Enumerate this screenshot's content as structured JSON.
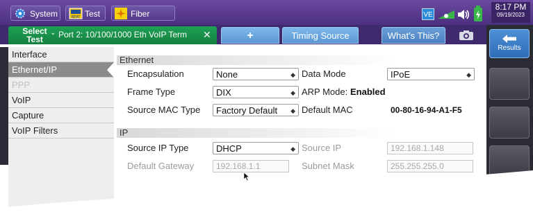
{
  "topbar": {
    "system_label": "System",
    "test_label": "Test",
    "bert_badge": "BERT",
    "fiber_label": "Fiber Optics",
    "ve_badge": "VE",
    "clock_time": "8:17 PM",
    "clock_date": "09/19/2023"
  },
  "tabs": {
    "select_test_line1": "Select",
    "select_test_line2": "Test",
    "port_label": "Port 2: 10/100/1000 Eth VoIP Term",
    "close_symbol": "✕",
    "add_label": "+",
    "timing_source": "Timing Source",
    "whats_this": "What's This?"
  },
  "sidebar": {
    "items": [
      {
        "label": "Interface",
        "state": "normal"
      },
      {
        "label": "Ethernet/IP",
        "state": "active"
      },
      {
        "label": "PPP",
        "state": "disabled"
      },
      {
        "label": "VoIP",
        "state": "normal"
      },
      {
        "label": "Capture",
        "state": "normal"
      },
      {
        "label": "VoIP Filters",
        "state": "normal"
      }
    ]
  },
  "ethernet": {
    "section_title": "Ethernet",
    "encapsulation_label": "Encapsulation",
    "encapsulation_value": "None",
    "data_mode_label": "Data Mode",
    "data_mode_value": "IPoE",
    "frame_type_label": "Frame Type",
    "frame_type_value": "DIX",
    "arp_mode_label": "ARP Mode:",
    "arp_mode_value": "Enabled",
    "source_mac_type_label": "Source MAC Type",
    "source_mac_type_value": "Factory Default",
    "default_mac_label": "Default MAC",
    "default_mac_value": "00-80-16-94-A1-F5"
  },
  "ip": {
    "section_title": "IP",
    "source_ip_type_label": "Source IP Type",
    "source_ip_type_value": "DHCP",
    "source_ip_label": "Source IP",
    "source_ip_value": "192.168.1.148",
    "default_gateway_label": "Default Gateway",
    "default_gateway_value": "192.168.1.1",
    "subnet_mask_label": "Subnet Mask",
    "subnet_mask_value": "255.255.255.0"
  },
  "right_panel": {
    "results_label": "Results"
  },
  "icons": {
    "gear": "gear-icon",
    "test": "test-icon",
    "fiber": "fiber-optics-icon",
    "link": "link-icon",
    "speaker": "speaker-icon",
    "battery": "battery-icon",
    "camera": "camera-icon",
    "back": "back-arrow-icon",
    "cursor": "cursor-icon"
  },
  "colors": {
    "topbar": "#5a3c8f",
    "select_test": "#1a9a4e",
    "tab_blue": "#6aa6e0",
    "sidebar_active": "#8b8b8b"
  }
}
